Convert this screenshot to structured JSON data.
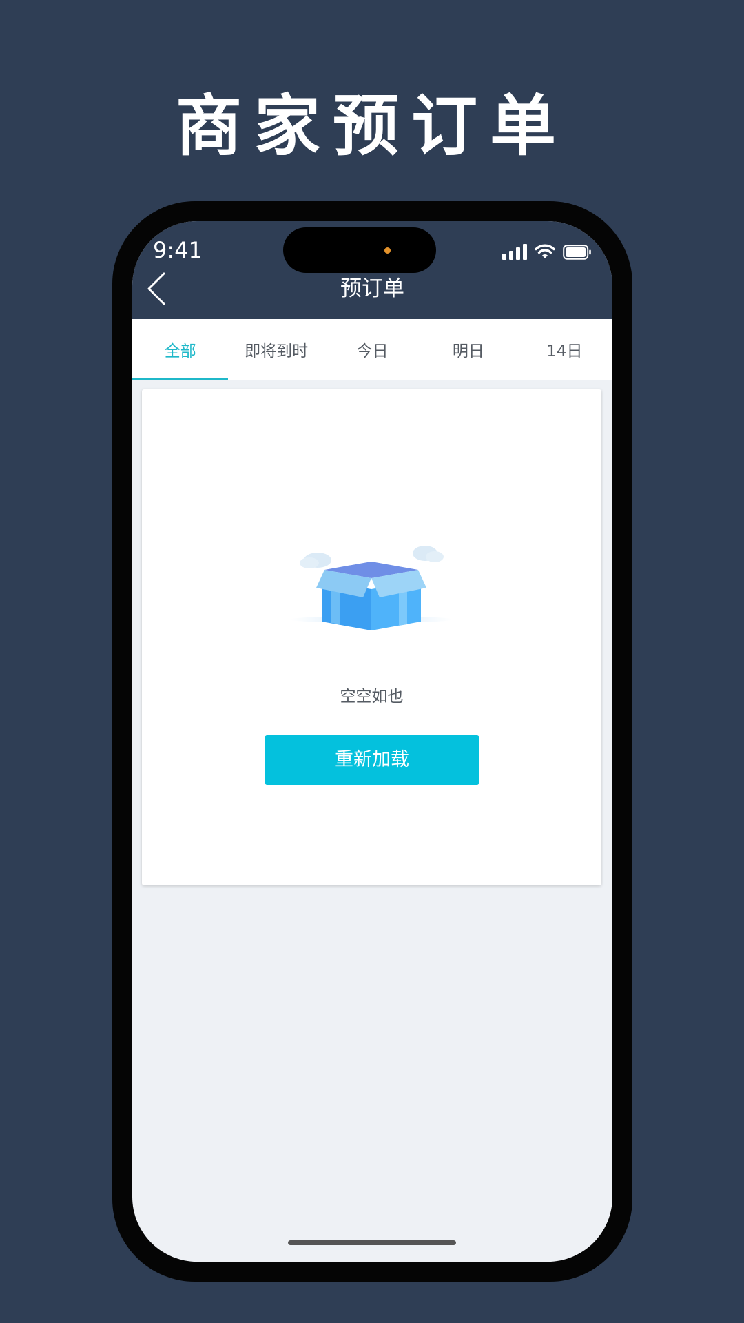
{
  "hero": {
    "title": "商家预订单"
  },
  "status_bar": {
    "time": "9:41",
    "icons": [
      "cellular-signal-icon",
      "wifi-icon",
      "battery-icon"
    ]
  },
  "navbar": {
    "title": "预订单",
    "back_icon": "chevron-left-icon"
  },
  "tabs": [
    {
      "label": "全部",
      "active": true
    },
    {
      "label": "即将到时",
      "active": false
    },
    {
      "label": "今日",
      "active": false
    },
    {
      "label": "明日",
      "active": false
    },
    {
      "label": "14日",
      "active": false
    }
  ],
  "empty_state": {
    "illustration": "empty-box-icon",
    "message": "空空如也",
    "reload_label": "重新加载"
  },
  "colors": {
    "background": "#2f3e55",
    "accent": "#1fb8c9",
    "button": "#04c1dd",
    "content_bg": "#eef1f5"
  }
}
